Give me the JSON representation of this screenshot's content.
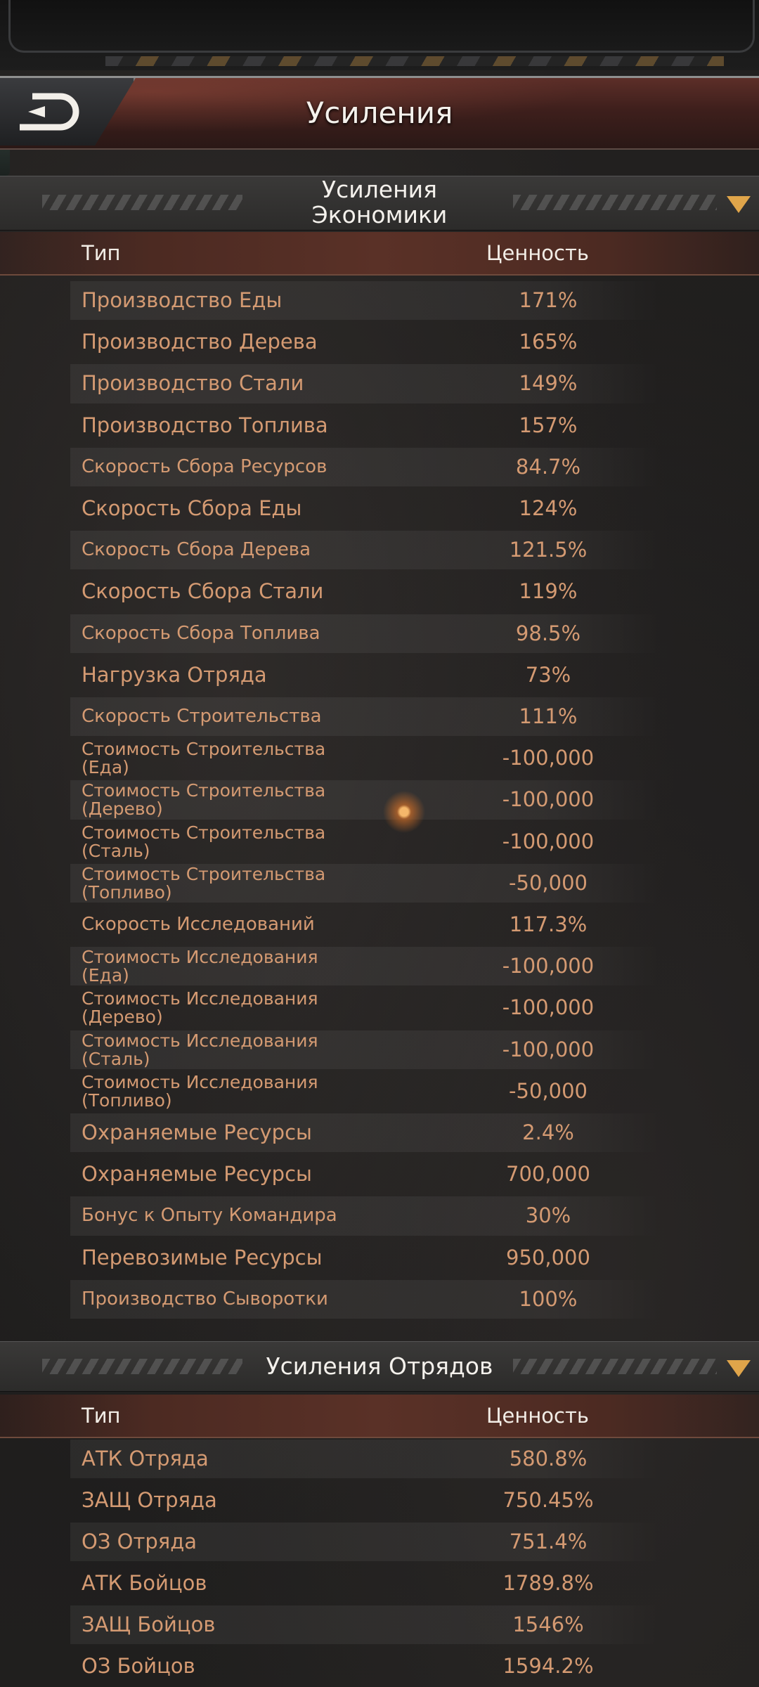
{
  "header": {
    "title": "Усиления"
  },
  "economy": {
    "title_line1": "Усиления",
    "title_line2": "Экономики",
    "col_type": "Тип",
    "col_value": "Ценность",
    "rows": [
      {
        "name": "Производство Еды",
        "value": "171%"
      },
      {
        "name": "Производство Дерева",
        "value": "165%"
      },
      {
        "name": "Производство Стали",
        "value": "149%"
      },
      {
        "name": "Производство Топлива",
        "value": "157%"
      },
      {
        "name": "Скорость Сбора Ресурсов",
        "value": "84.7%"
      },
      {
        "name": "Скорость Сбора Еды",
        "value": "124%"
      },
      {
        "name": "Скорость Сбора Дерева",
        "value": "121.5%"
      },
      {
        "name": "Скорость Сбора Стали",
        "value": "119%"
      },
      {
        "name": "Скорость Сбора Топлива",
        "value": "98.5%"
      },
      {
        "name": "Нагрузка Отряда",
        "value": "73%"
      },
      {
        "name": "Скорость Строительства",
        "value": "111%"
      },
      {
        "name": "Стоимость Строительства (Еда)",
        "value": "-100,000"
      },
      {
        "name": "Стоимость Строительства (Дерево)",
        "value": "-100,000"
      },
      {
        "name": "Стоимость Строительства (Сталь)",
        "value": "-100,000"
      },
      {
        "name": "Стоимость Строительства (Топливо)",
        "value": "-50,000"
      },
      {
        "name": "Скорость Исследований",
        "value": "117.3%"
      },
      {
        "name": "Стоимость Исследования (Еда)",
        "value": "-100,000"
      },
      {
        "name": "Стоимость Исследования (Дерево)",
        "value": "-100,000"
      },
      {
        "name": "Стоимость Исследования (Сталь)",
        "value": "-100,000"
      },
      {
        "name": "Стоимость Исследования (Топливо)",
        "value": "-50,000"
      },
      {
        "name": "Охраняемые Ресурсы",
        "value": "2.4%"
      },
      {
        "name": "Охраняемые Ресурсы",
        "value": "700,000"
      },
      {
        "name": "Бонус к Опыту Командира",
        "value": "30%"
      },
      {
        "name": "Перевозимые Ресурсы",
        "value": "950,000"
      },
      {
        "name": "Производство Сыворотки",
        "value": "100%"
      }
    ]
  },
  "troops": {
    "title": "Усиления Отрядов",
    "col_type": "Тип",
    "col_value": "Ценность",
    "rows": [
      {
        "name": "АТК Отряда",
        "value": "580.8%"
      },
      {
        "name": "ЗАЩ Отряда",
        "value": "750.45%"
      },
      {
        "name": "ОЗ Отряда",
        "value": "751.4%"
      },
      {
        "name": "АТК Бойцов",
        "value": "1789.8%"
      },
      {
        "name": "ЗАЩ Бойцов",
        "value": "1546%"
      },
      {
        "name": "ОЗ Бойцов",
        "value": "1594.2%"
      }
    ]
  },
  "colors": {
    "accent": "#e0a54a",
    "row_text": "#d49a72"
  }
}
